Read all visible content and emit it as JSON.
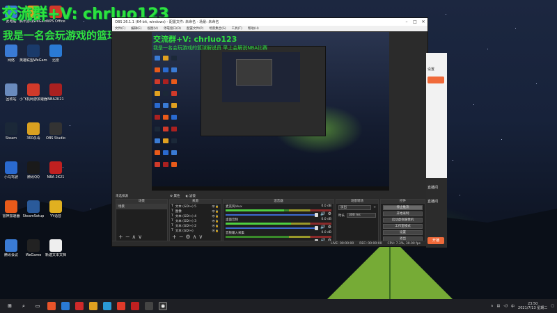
{
  "overlay": {
    "line1": "交流群+V: chrluo123",
    "line2": "我是一名会玩游戏的篮球解说员 早上会解说NBA比赛"
  },
  "desktop_icons": [
    {
      "label": "此电脑",
      "icon": "computer-icon",
      "color": "#3a7bd5"
    },
    {
      "label": "网络",
      "icon": "network-icon",
      "color": "#3a7bd5"
    },
    {
      "label": "回收站",
      "icon": "recycle-bin-icon",
      "color": "#6a8bbd"
    },
    {
      "label": "Steam",
      "icon": "steam-icon",
      "color": "#1b2838"
    },
    {
      "label": "小马驾驶",
      "icon": "app-icon",
      "color": "#2a6ad0"
    },
    {
      "label": "雷神加速器",
      "icon": "app-icon",
      "color": "#e85a1a"
    },
    {
      "label": "腾讯会议",
      "icon": "app-icon",
      "color": "#3a7bd5"
    },
    {
      "label": "腾讯游戏WeGame",
      "icon": "app-icon",
      "color": "#e0a020"
    },
    {
      "label": "英雄联盟WeGame",
      "icon": "app-icon",
      "color": "#1a3a6a"
    },
    {
      "label": "小飞机网游加速器",
      "icon": "app-icon",
      "color": "#d03a2a"
    },
    {
      "label": "360杀毒",
      "icon": "app-icon",
      "color": "#d9a020"
    },
    {
      "label": "腾讯QQ",
      "icon": "app-icon",
      "color": "#1a1a1a"
    },
    {
      "label": "SteamSetup",
      "icon": "app-icon",
      "color": "#2a5a9a"
    },
    {
      "label": "WeGame",
      "icon": "app-icon",
      "color": "#222"
    },
    {
      "label": "WPS Office",
      "icon": "app-icon",
      "color": "#d03a2a"
    },
    {
      "label": "迅雷",
      "icon": "app-icon",
      "color": "#2a7ad5"
    },
    {
      "label": "NBA2K21",
      "icon": "app-icon",
      "color": "#aa2020"
    },
    {
      "label": "OBS Studio",
      "icon": "obs-icon",
      "color": "#333"
    },
    {
      "label": "NBA 2K21",
      "icon": "app-icon",
      "color": "#c02020"
    },
    {
      "label": "YY语音",
      "icon": "app-icon",
      "color": "#e0b020"
    },
    {
      "label": "新建文本文档",
      "icon": "file-icon",
      "color": "#eee"
    }
  ],
  "obs": {
    "title": "OBS 26.1.1 (64-bit, windows) - 配置文件: 未命名 - 场景: 未命名",
    "menu": [
      "文件(F)",
      "编辑(E)",
      "视图(V)",
      "停靠窗口(D)",
      "配置文件(P)",
      "场景集合(S)",
      "工具(T)",
      "帮助(H)"
    ],
    "scene_header": "未选择源",
    "properties_label": "属性",
    "filters_label": "滤镜",
    "docks": {
      "scenes_title": "场景",
      "sources_title": "来源",
      "mixer_title": "混音器",
      "transitions_title": "场景转场",
      "controls_title": "控件"
    },
    "scenes": [
      "场景"
    ],
    "sources": [
      "文本 (GDI+) 5",
      "图像",
      "文本 (GDI+) 4",
      "文本 (GDI+) 3",
      "文本 (GDI+) 2",
      "文本 (GDI+)"
    ],
    "mixer": [
      {
        "name": "麦克风/Aux",
        "db": "0.0 dB",
        "level": 0.55
      },
      {
        "name": "桌面音频",
        "db": "0.0 dB",
        "level": 0.62
      },
      {
        "name": "音频输入采集",
        "db": "0.0 dB",
        "level": 0.0
      }
    ],
    "transition": {
      "type": "淡出",
      "duration_label": "时长",
      "duration": "300 ms"
    },
    "controls": [
      "停止推流",
      "开始录制",
      "启动虚拟摄像机",
      "工作室模式",
      "设置",
      "退出"
    ],
    "status": {
      "live": "LIVE: 00:00:00",
      "rec": "REC: 00:00:00",
      "cpu": "CPU: 7.3%, 30.00 fps"
    }
  },
  "right_app": {
    "label1": "直播间",
    "label2": "设置",
    "btn": "开播",
    "label3": "直播间"
  },
  "taskbar": {
    "time": "23:50",
    "date": "2021/7/13 星期二",
    "lang": "中"
  }
}
